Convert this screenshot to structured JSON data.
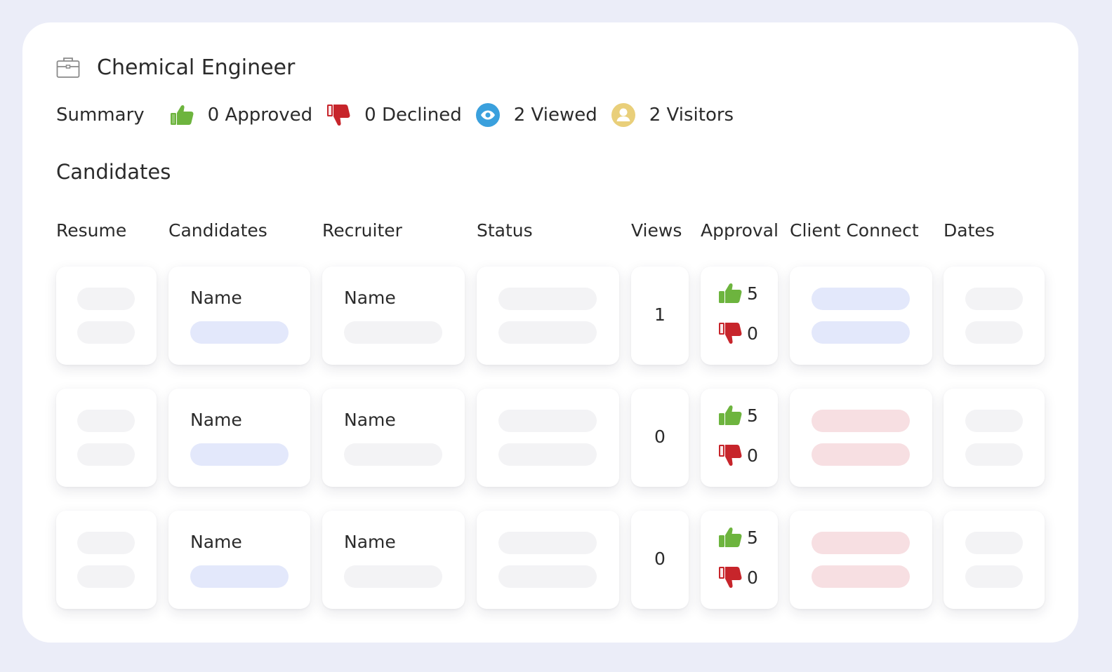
{
  "job": {
    "title": "Chemical Engineer",
    "icon": "briefcase-icon"
  },
  "summary": {
    "label": "Summary",
    "approved": "0 Approved",
    "declined": "0 Declined",
    "viewed": "2 Viewed",
    "visitors": "2 Visitors"
  },
  "candidates_section": {
    "title": "Candidates",
    "columns": [
      "Resume",
      "Candidates",
      "Recruiter",
      "Status",
      "Views",
      "Approval",
      "Client Connect",
      "Dates"
    ]
  },
  "rows": [
    {
      "candidate": "Name",
      "recruiter": "Name",
      "views": "1",
      "approve": "5",
      "decline": "0",
      "client_connect_state": "blue"
    },
    {
      "candidate": "Name",
      "recruiter": "Name",
      "views": "0",
      "approve": "5",
      "decline": "0",
      "client_connect_state": "pink"
    },
    {
      "candidate": "Name",
      "recruiter": "Name",
      "views": "0",
      "approve": "5",
      "decline": "0",
      "client_connect_state": "pink"
    }
  ],
  "colors": {
    "approve_green": "#6db43e",
    "decline_red": "#c7252b",
    "viewed_blue": "#3aa0dd",
    "visitor_gold": "#e9cf7a",
    "placeholder_gray": "#f3f3f5",
    "placeholder_blue": "#e3e8fb",
    "placeholder_pink": "#f7dfe2"
  }
}
